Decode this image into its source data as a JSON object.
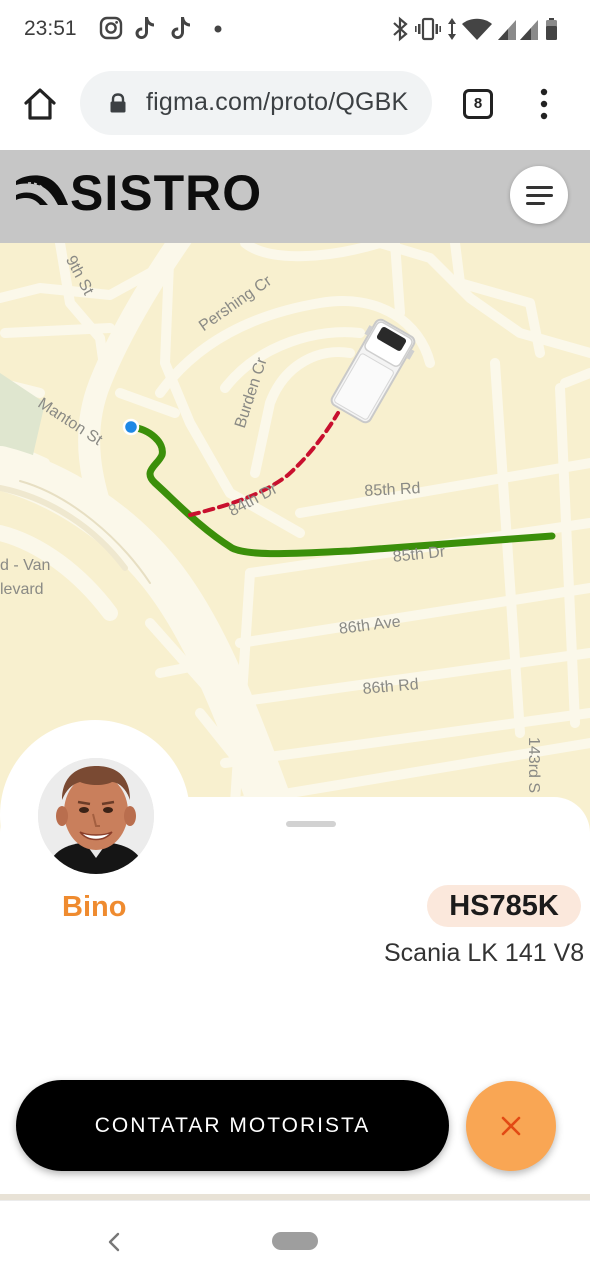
{
  "status_bar": {
    "time": "23:51",
    "left_icons": [
      "instagram-icon",
      "tiktok-icon",
      "tiktok-icon",
      "notification-dot-icon"
    ],
    "right_icons": [
      "bluetooth-icon",
      "vibrate-icon",
      "data-arrows-icon",
      "wifi-icon",
      "signal-icon",
      "signal-icon",
      "battery-icon"
    ]
  },
  "browser": {
    "url": "figma.com/proto/QGBK",
    "tab_count": "8"
  },
  "app": {
    "brand": "SISTRO",
    "accent_color": "#ef8b2f"
  },
  "map": {
    "labels": {
      "ninth_st": "9th St",
      "pershing_cr": "Pershing Cr",
      "burden_cr": "Burden Cr",
      "manton_st": "Manton St",
      "eightyfourth_dr": "84th Dr",
      "eightyfifth_rd": "85th Rd",
      "eightyfifth_dr": "85th Dr",
      "eightysixth_ave": "86th Ave",
      "eightysixth_rd": "86th Rd",
      "blvd_line1": "d - Van",
      "blvd_line2": "levard",
      "onefortythird_st": "143rd S"
    },
    "route_color": "#3b8f0a",
    "remaining_route_color": "#c8102e",
    "current_location_color": "#1e88e5"
  },
  "driver": {
    "name": "Bino",
    "plate": "HS785K",
    "truck_model": "Scania LK 141 V8"
  },
  "actions": {
    "contact_label": "CONTATAR MOTORISTA"
  }
}
